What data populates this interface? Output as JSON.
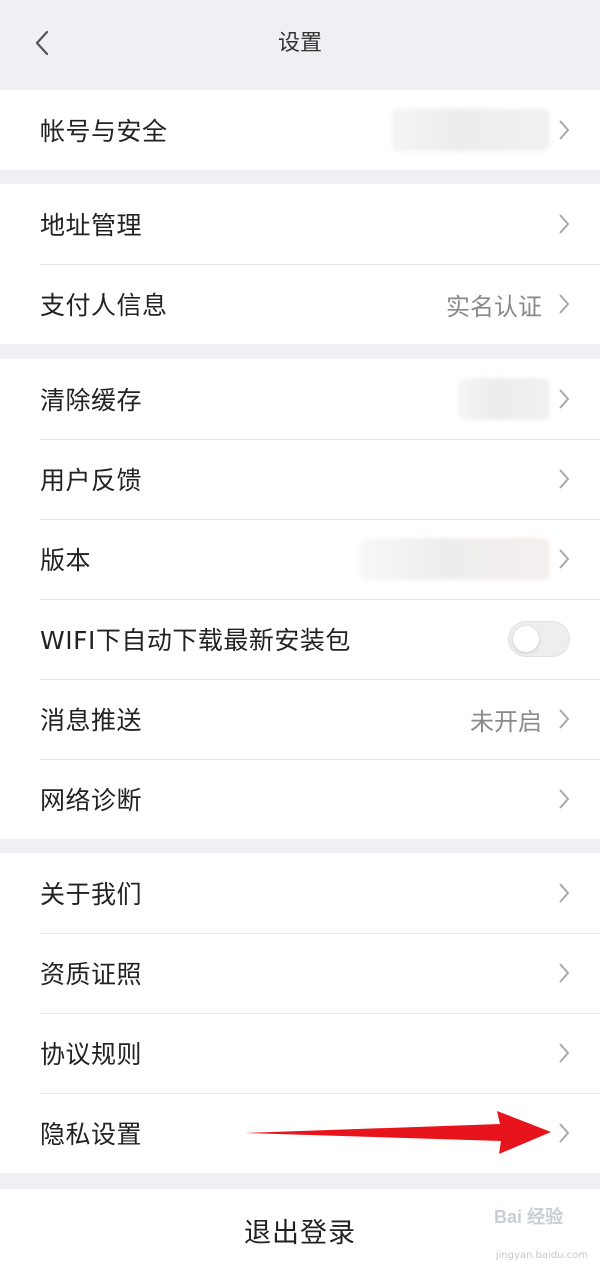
{
  "nav": {
    "title": "设置"
  },
  "groups": [
    {
      "rows": [
        {
          "label": "帐号与安全"
        }
      ]
    },
    {
      "rows": [
        {
          "label": "地址管理"
        },
        {
          "label": "支付人信息",
          "value": "实名认证"
        }
      ]
    },
    {
      "rows": [
        {
          "label": "清除缓存"
        },
        {
          "label": "用户反馈"
        },
        {
          "label": "版本"
        },
        {
          "label": "WIFI下自动下载最新安装包",
          "toggle": false
        },
        {
          "label": "消息推送",
          "value": "未开启"
        },
        {
          "label": "网络诊断"
        }
      ]
    },
    {
      "rows": [
        {
          "label": "关于我们"
        },
        {
          "label": "资质证照"
        },
        {
          "label": "协议规则"
        },
        {
          "label": "隐私设置"
        }
      ]
    }
  ],
  "logout": {
    "label": "退出登录"
  },
  "watermark": {
    "brand": "Bai 经验",
    "url": "jingyan.baidu.com"
  },
  "colors": {
    "arrow": "#e8141c",
    "background": "#efeff4"
  }
}
